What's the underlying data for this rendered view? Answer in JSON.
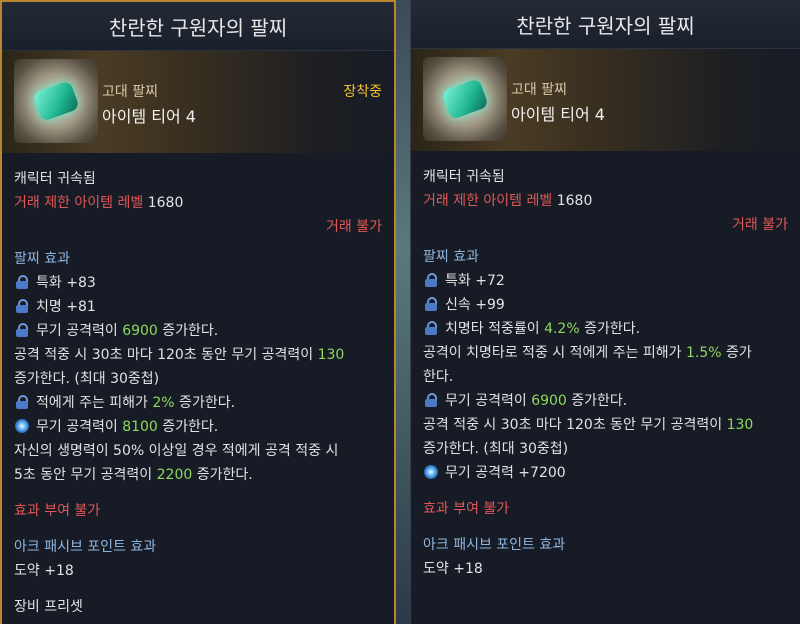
{
  "left": {
    "title": "찬란한 구원자의 팔찌",
    "grade": "고대 팔찌",
    "tier": "아이템 티어 4",
    "equipped": "장착중",
    "bound": "캐릭터 귀속됨",
    "trade_label": "거래 제한 아이템 레벨",
    "trade_level": "1680",
    "trade_status": "거래 불가",
    "effect_header": "팔찌 효과",
    "stats": [
      {
        "text": "특화 +83"
      },
      {
        "text": "치명 +81"
      }
    ],
    "eff1_a": "무기 공격력이 ",
    "eff1_val": "6900",
    "eff1_b": " 증가한다.",
    "eff2_a": "공격 적중 시 30초 마다 120초 동안 무기 공격력이 ",
    "eff2_val": "130",
    "eff2_b": "증가한다. (최대 30중첩)",
    "eff3_a": "적에게 주는 피해가 ",
    "eff3_val": "2%",
    "eff3_b": " 증가한다.",
    "eff4_a": "무기 공격력이 ",
    "eff4_val": "8100",
    "eff4_b": " 증가한다.",
    "eff5_a": "자신의 생명력이 50% 이상일 경우 적에게 공격 적중 시",
    "eff5_b": "5초 동안 무기 공격력이 ",
    "eff5_val": "2200",
    "eff5_c": " 증가한다.",
    "no_effect": "효과 부여 불가",
    "ark_header": "아크 패시브 포인트 효과",
    "ark_value": "도약 +18",
    "preset_header": "장비 프리셋"
  },
  "right": {
    "title": "찬란한 구원자의 팔찌",
    "grade": "고대 팔찌",
    "tier": "아이템 티어 4",
    "bound": "캐릭터 귀속됨",
    "trade_label": "거래 제한 아이템 레벨",
    "trade_level": "1680",
    "trade_status": "거래 불가",
    "effect_header": "팔찌 효과",
    "stats": [
      {
        "text": "특화 +72"
      },
      {
        "text": "신속 +99"
      }
    ],
    "eff1_a": "치명타 적중률이 ",
    "eff1_val": "4.2%",
    "eff1_b": " 증가한다.",
    "eff2_a": "공격이 치명타로 적중 시 적에게 주는 피해가 ",
    "eff2_val": "1.5%",
    "eff2_b": " 증가",
    "eff2_c": "한다.",
    "eff3_a": "무기 공격력이 ",
    "eff3_val": "6900",
    "eff3_b": " 증가한다.",
    "eff4_a": "공격 적중 시 30초 마다 120초 동안 무기 공격력이 ",
    "eff4_val": "130",
    "eff4_b": "증가한다. (최대 30중첩)",
    "eff5": "무기 공격력 +7200",
    "no_effect": "효과 부여 불가",
    "ark_header": "아크 패시브 포인트 효과",
    "ark_value": "도약 +18"
  },
  "colors": {
    "accent_gold": "#f2c230",
    "red": "#e15757",
    "green": "#8ed85e",
    "blue": "#8fb5df",
    "border_gold": "#b8862e"
  },
  "icons": [
    "lock-icon",
    "swirl-icon",
    "bracelet-icon"
  ]
}
